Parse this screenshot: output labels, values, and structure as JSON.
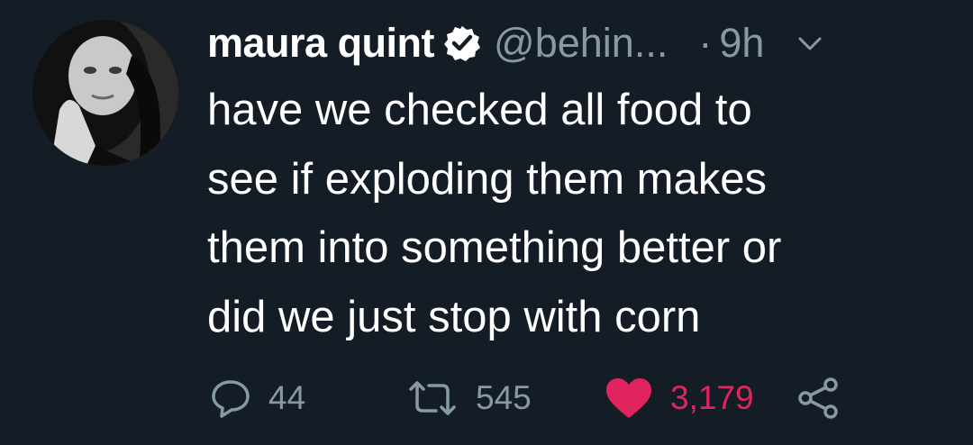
{
  "tweet": {
    "author_name": "maura quint",
    "handle": "@behin...",
    "separator": "·",
    "time": "9h",
    "text_lines": [
      "have we checked all food to",
      "see if exploding them makes",
      "them into something better or",
      "did we just stop with corn"
    ],
    "verified": true
  },
  "actions": {
    "reply_count": "44",
    "retweet_count": "545",
    "like_count": "3,179",
    "liked": true
  },
  "icons": {
    "avatar": "avatar",
    "verified": "verified-badge-icon",
    "more": "chevron-down-icon",
    "reply": "reply-icon",
    "retweet": "retweet-icon",
    "like": "heart-icon",
    "share": "share-icon"
  },
  "colors": {
    "background": "#141d26",
    "text": "#ffffff",
    "muted": "#8899a6",
    "like": "#e0245e"
  }
}
